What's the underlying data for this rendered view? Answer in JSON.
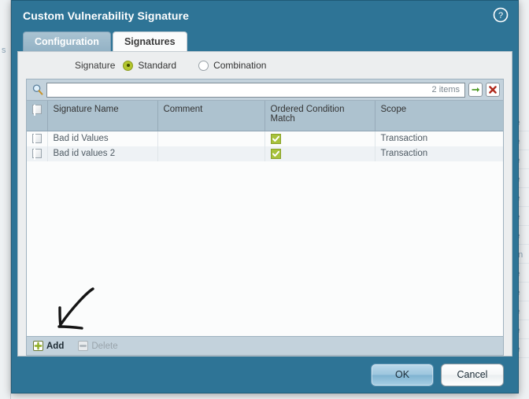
{
  "dialog": {
    "title": "Custom Vulnerability Signature",
    "help_icon": "help-circle-icon",
    "accent_color": "#2e7496",
    "tabs": [
      {
        "label": "Configuration",
        "active": false
      },
      {
        "label": "Signatures",
        "active": true
      }
    ],
    "footer": {
      "ok_label": "OK",
      "cancel_label": "Cancel"
    }
  },
  "signature_type": {
    "label": "Signature",
    "options": [
      {
        "label": "Standard",
        "selected": true
      },
      {
        "label": "Combination",
        "selected": false
      }
    ],
    "selected_color": "#b3c62e"
  },
  "search": {
    "icon": "magnifier-icon",
    "value": "",
    "placeholder": "",
    "item_count": "2 items",
    "go_button": "arrow-right-icon",
    "clear_button": "red-x-icon",
    "go_color": "#4f9b27",
    "clear_color": "#b02b1e"
  },
  "grid": {
    "columns": [
      "Signature Name",
      "Comment",
      "Ordered Condition Match",
      "Scope"
    ],
    "rows": [
      {
        "selected": false,
        "signature_name": "Bad id Values",
        "comment": "",
        "ordered_condition_match": true,
        "scope": "Transaction"
      },
      {
        "selected": false,
        "signature_name": "Bad id values 2",
        "comment": "",
        "ordered_condition_match": true,
        "scope": "Transaction"
      }
    ],
    "check_color": "#a8c23c",
    "footer": {
      "add_label": "Add",
      "add_enabled": true,
      "delete_label": "Delete",
      "delete_enabled": false
    }
  },
  "annotation": {
    "type": "hand-drawn-arrow",
    "points_to": "Add"
  },
  "background": {
    "left_fragment": "s",
    "right_fragments": [
      "le",
      "le",
      "le",
      "le",
      "le",
      "le",
      "le",
      "en",
      "le",
      "le",
      "le",
      "le",
      "le"
    ]
  }
}
